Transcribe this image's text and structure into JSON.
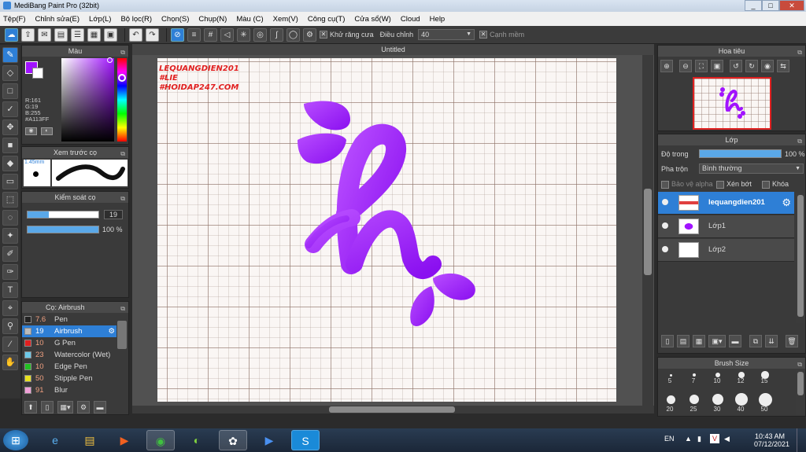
{
  "window": {
    "title": "MediBang Paint Pro (32bit)",
    "minimize": "_",
    "maximize": "□",
    "close": "✕"
  },
  "menu": [
    "Tệp(F)",
    "Chỉnh sửa(E)",
    "Lớp(L)",
    "Bộ lọc(R)",
    "Chọn(S)",
    "Chụp(N)",
    "Màu (C)",
    "Xem(V)",
    "Công cụ(T)",
    "Cửa sổ(W)",
    "Cloud",
    "Help"
  ],
  "toolbar": {
    "antialias_label": "Khử răng cưa",
    "adjust_label": "Điều chỉnh",
    "adjust_value": "40",
    "smooth_label": "Cạnh mềm"
  },
  "color_panel": {
    "title": "Màu",
    "r": "R:161",
    "g": "G:19",
    "b": "B:255",
    "hex": "#A113FF",
    "accent": "#A113FF"
  },
  "brush_preview": {
    "title": "Xem trước cọ",
    "size": "1.45mm"
  },
  "brush_control": {
    "title": "Kiểm soát cọ",
    "size_value": "19",
    "opacity_value": "100 %",
    "size_fraction": 0.3,
    "opacity_fraction": 1.0
  },
  "brush_list": {
    "title": "Cọ: Airbrush",
    "items": [
      {
        "size": "7.6",
        "name": "Pen",
        "color": "#222222"
      },
      {
        "size": "19",
        "name": "Airbrush",
        "color": "#bbbbbb"
      },
      {
        "size": "10",
        "name": "G Pen",
        "color": "#e02020"
      },
      {
        "size": "23",
        "name": "Watercolor (Wet)",
        "color": "#6cc8e8"
      },
      {
        "size": "10",
        "name": "Edge Pen",
        "color": "#22c022"
      },
      {
        "size": "50",
        "name": "Stipple Pen",
        "color": "#e8e020"
      },
      {
        "size": "91",
        "name": "Blur",
        "color": "#f0a0d8"
      }
    ]
  },
  "canvas": {
    "tab": "Untitled",
    "watermark": [
      "LEQUANGDIEN201",
      "#LIE",
      "#HOIDAP247.COM"
    ],
    "letter_color": "#A113FF"
  },
  "navigator": {
    "title": "Hoa tiêu"
  },
  "layers": {
    "title": "Lớp",
    "opacity_label": "Độ trong",
    "opacity_value": "100 %",
    "blend_label": "Pha trộn",
    "blend_value": "Bình thường",
    "protect_alpha": "Bảo vệ alpha",
    "clipping": "Xén bớt",
    "lock": "Khóa",
    "items": [
      {
        "name": "lequangdien201",
        "selected": true
      },
      {
        "name": "Lớp1",
        "selected": false
      },
      {
        "name": "Lớp2",
        "selected": false
      }
    ]
  },
  "brush_size": {
    "title": "Brush Size",
    "sizes": [
      "5",
      "7",
      "10",
      "12",
      "15",
      "20",
      "25",
      "30",
      "40",
      "50"
    ]
  },
  "taskbar": {
    "lang": "EN",
    "time": "10:43 AM",
    "date": "07/12/2021"
  }
}
